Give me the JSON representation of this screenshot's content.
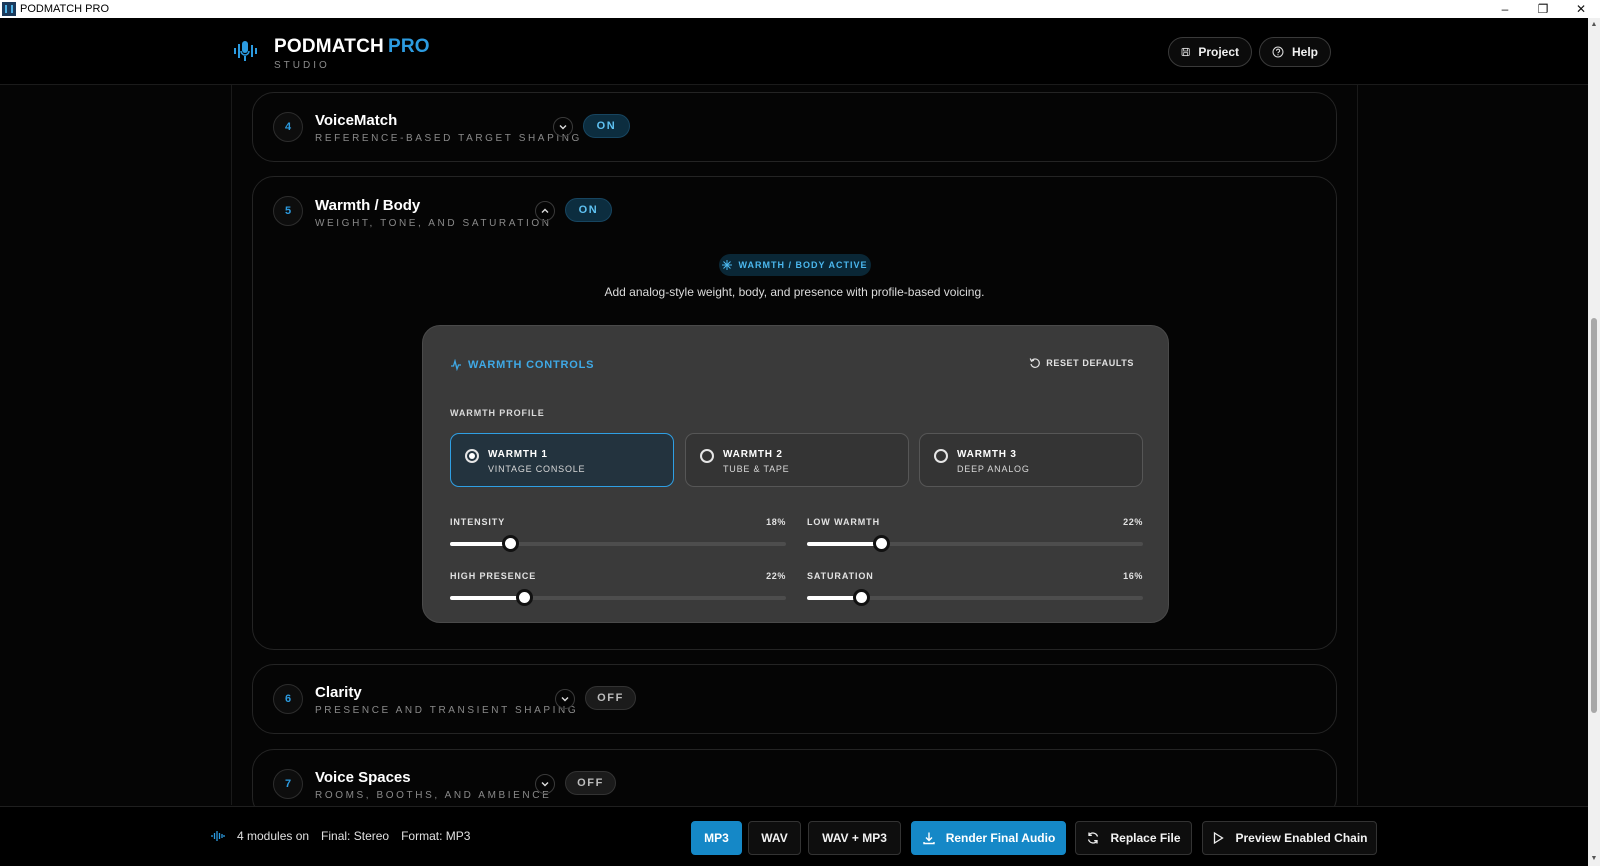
{
  "window": {
    "title": "PODMATCH PRO"
  },
  "header": {
    "brand_main": "PODMATCH",
    "brand_accent": "PRO",
    "brand_sub": "STUDIO",
    "project_label": "Project",
    "help_label": "Help"
  },
  "modules": [
    {
      "num": "4",
      "title": "VoiceMatch",
      "subtitle": "REFERENCE-BASED TARGET SHAPING",
      "state": "ON",
      "expanded": false
    },
    {
      "num": "5",
      "title": "Warmth / Body",
      "subtitle": "WEIGHT, TONE, AND SATURATION",
      "state": "ON",
      "expanded": true
    },
    {
      "num": "6",
      "title": "Clarity",
      "subtitle": "PRESENCE AND TRANSIENT SHAPING",
      "state": "OFF",
      "expanded": false
    },
    {
      "num": "7",
      "title": "Voice Spaces",
      "subtitle": "ROOMS, BOOTHS, AND AMBIENCE",
      "state": "OFF",
      "expanded": false
    }
  ],
  "warmth": {
    "badge": "WARMTH / BODY ACTIVE",
    "description": "Add analog-style weight, body, and presence with profile-based voicing.",
    "controls_title": "WARMTH CONTROLS",
    "reset_label": "RESET DEFAULTS",
    "profile_label": "WARMTH PROFILE",
    "profiles": [
      {
        "name": "WARMTH 1",
        "sub": "VINTAGE CONSOLE",
        "selected": true
      },
      {
        "name": "WARMTH 2",
        "sub": "TUBE & TAPE",
        "selected": false
      },
      {
        "name": "WARMTH 3",
        "sub": "DEEP ANALOG",
        "selected": false
      }
    ],
    "sliders": [
      {
        "label": "INTENSITY",
        "value_text": "18%",
        "value": 0.18
      },
      {
        "label": "LOW WARMTH",
        "value_text": "22%",
        "value": 0.22
      },
      {
        "label": "HIGH PRESENCE",
        "value_text": "22%",
        "value": 0.22
      },
      {
        "label": "SATURATION",
        "value_text": "16%",
        "value": 0.16
      }
    ]
  },
  "footer": {
    "modules_on": "4 modules on",
    "final": "Final: Stereo",
    "format": "Format: MP3",
    "fmt_mp3": "MP3",
    "fmt_wav": "WAV",
    "fmt_both": "WAV + MP3",
    "render": "Render Final Audio",
    "replace": "Replace File",
    "preview": "Preview Enabled Chain"
  },
  "colors": {
    "accent": "#2c9be0",
    "on_bg": "#0c2d3f",
    "panel": "#3a3a3a"
  }
}
